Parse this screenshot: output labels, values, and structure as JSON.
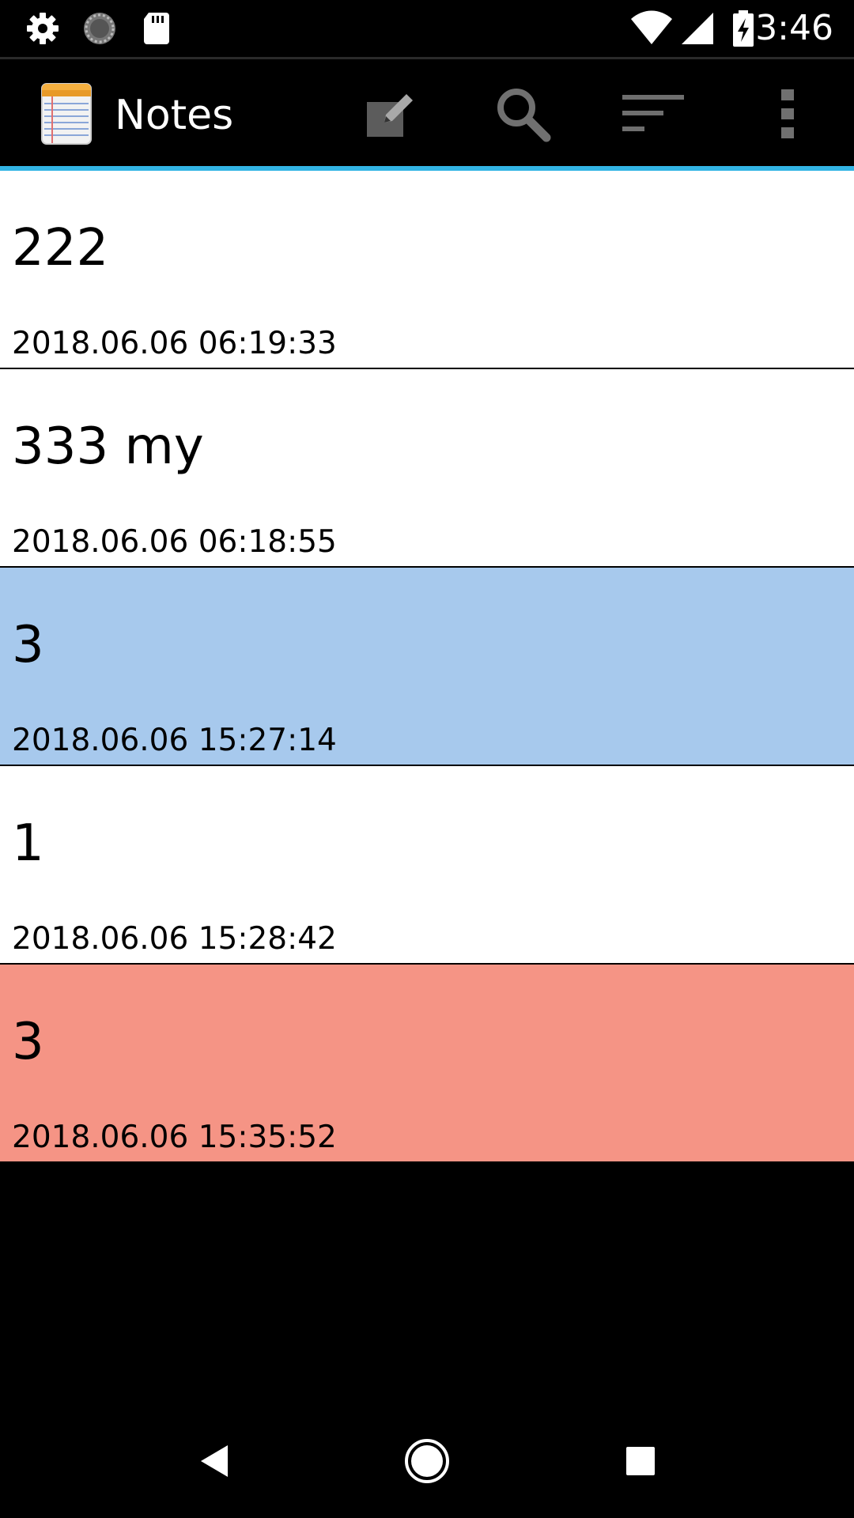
{
  "status_bar": {
    "time": "3:46",
    "icons": [
      "settings-icon",
      "sync-icon",
      "sd-card-icon",
      "wifi-icon",
      "signal-icon",
      "battery-charging-icon"
    ]
  },
  "action_bar": {
    "title": "Notes",
    "app_icon": "notepad-icon",
    "actions": [
      "new-note-icon",
      "search-icon",
      "sort-icon",
      "overflow-menu-icon"
    ],
    "accent_color": "#33b5e5"
  },
  "notes": [
    {
      "title": "222",
      "date": "2018.06.06 06:19:33",
      "color": "#ffffff"
    },
    {
      "title": "333 my",
      "date": "2018.06.06 06:18:55",
      "color": "#ffffff"
    },
    {
      "title": "3",
      "date": "2018.06.06 15:27:14",
      "color": "#a7c9ed"
    },
    {
      "title": "1",
      "date": "2018.06.06 15:28:42",
      "color": "#ffffff"
    },
    {
      "title": "3",
      "date": "2018.06.06 15:35:52",
      "color": "#f59485"
    }
  ],
  "nav_bar": {
    "buttons": [
      "back-icon",
      "home-icon",
      "recents-icon"
    ]
  }
}
